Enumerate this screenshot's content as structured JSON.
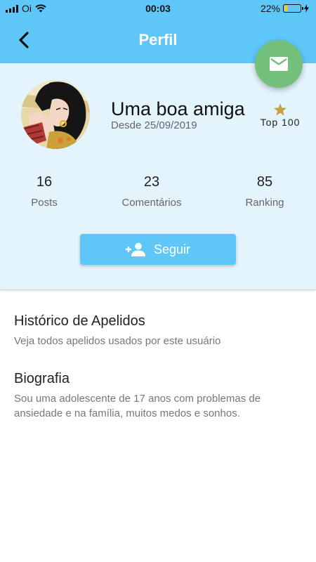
{
  "status_bar": {
    "carrier": "Oi",
    "time": "00:03",
    "battery_percent": "22%",
    "battery_level": 0.22,
    "icons": [
      "signal-icon",
      "wifi-icon",
      "battery-icon",
      "charging-icon"
    ]
  },
  "header": {
    "title": "Perfil",
    "back_icon": "back-arrow-icon",
    "message_icon": "mail-icon"
  },
  "profile": {
    "name": "Uma boa amiga",
    "since": "Desde 25/09/2019",
    "rank_label": "Top 100",
    "rank_icon": "star-icon",
    "stats": [
      {
        "value": "16",
        "label": "Posts"
      },
      {
        "value": "23",
        "label": "Comentários"
      },
      {
        "value": "85",
        "label": "Ranking"
      }
    ],
    "follow_button": {
      "label": "Seguir",
      "icon": "person-add-icon"
    }
  },
  "sections": [
    {
      "title": "Histórico de Apelidos",
      "subtitle": "Veja todos apelidos usados por este usuário"
    },
    {
      "title": "Biografia",
      "subtitle": "Sou uma adolescente de 17 anos com problemas de ansiedade e na família, muitos medos e sonhos."
    }
  ],
  "colors": {
    "primary": "#5ec7f7",
    "card_bg": "#e4f4fd",
    "fab": "#72c07a",
    "star": "#c8a142",
    "battery": "#f2c53d"
  }
}
